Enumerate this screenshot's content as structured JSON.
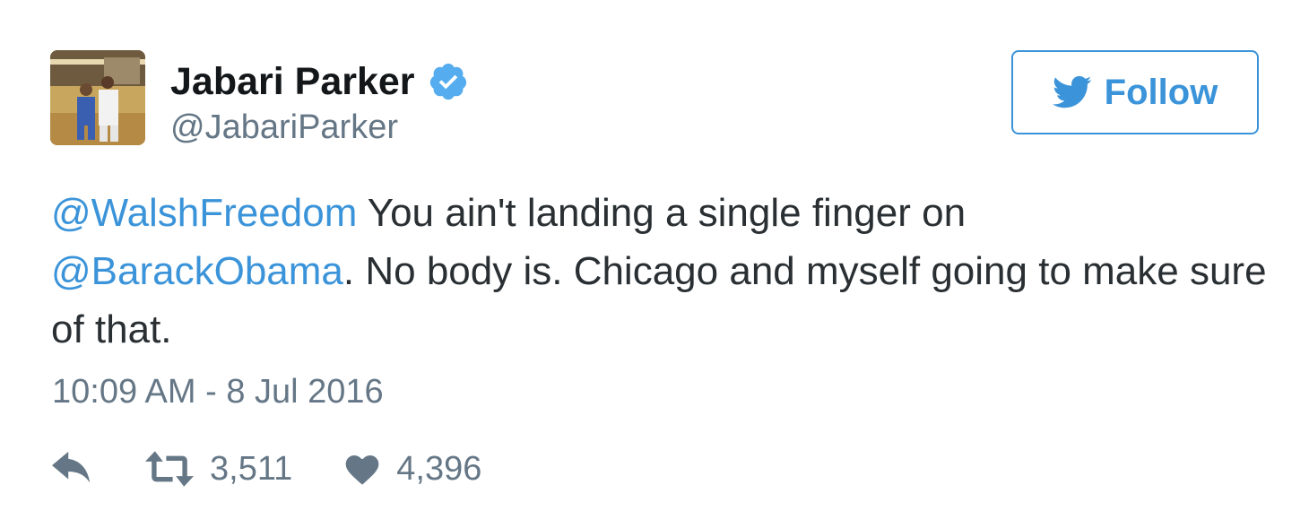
{
  "user": {
    "display_name": "Jabari Parker",
    "handle": "@JabariParker",
    "verified": true,
    "avatar_icon": "profile-photo"
  },
  "follow_button": {
    "label": "Follow",
    "icon": "twitter-bird-icon"
  },
  "tweet": {
    "mention_1": "@WalshFreedom",
    "text_1": " You ain't landing a single finger on ",
    "mention_2": "@BarackObama",
    "text_2": ". No body is. Chicago and myself going to make sure of that.",
    "timestamp": "10:09 AM - 8 Jul 2016"
  },
  "actions": {
    "reply_icon": "reply-icon",
    "retweet_icon": "retweet-icon",
    "retweet_count": "3,511",
    "like_icon": "heart-icon",
    "like_count": "4,396"
  },
  "colors": {
    "link": "#3b94d9",
    "text": "#292f33",
    "muted": "#657786",
    "verified": "#55acee"
  }
}
